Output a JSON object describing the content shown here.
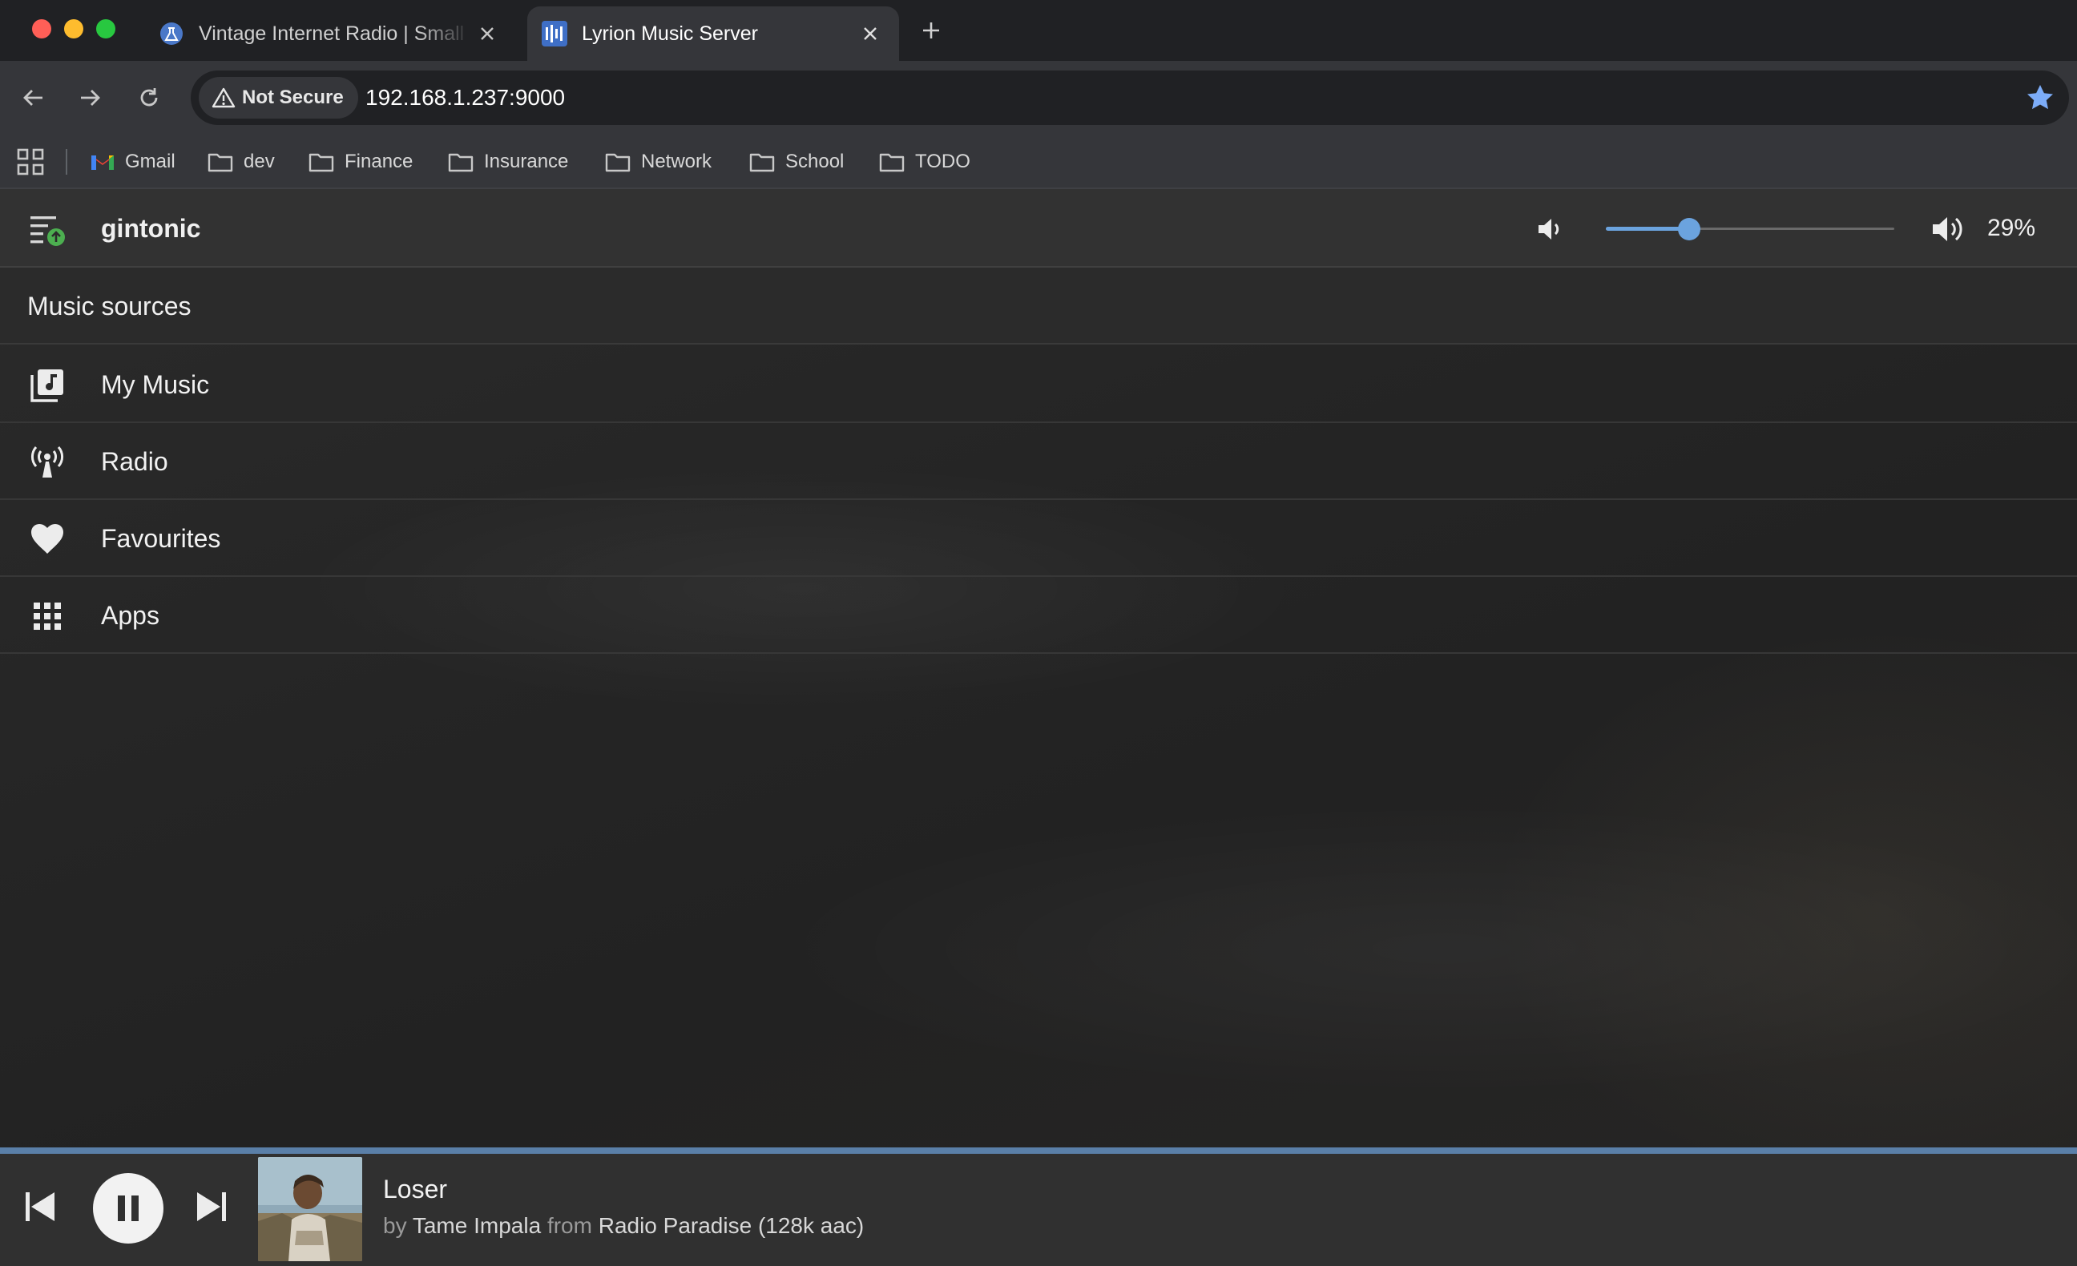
{
  "browser": {
    "tabs": [
      {
        "title": "Vintage Internet Radio | Small",
        "active": false,
        "favicon": "flask-icon"
      },
      {
        "title": "Lyrion Music Server",
        "active": true,
        "favicon": "lyrion-logo-icon"
      }
    ],
    "security_label": "Not Secure",
    "url": "192.168.1.237:9000",
    "bookmarks": [
      {
        "label": "Gmail",
        "icon": "gmail-icon"
      },
      {
        "label": "dev",
        "icon": "folder-icon"
      },
      {
        "label": "Finance",
        "icon": "folder-icon"
      },
      {
        "label": "Insurance",
        "icon": "folder-icon"
      },
      {
        "label": "Network",
        "icon": "folder-icon"
      },
      {
        "label": "School",
        "icon": "folder-icon"
      },
      {
        "label": "TODO",
        "icon": "folder-icon"
      }
    ]
  },
  "header": {
    "player_name": "gintonic",
    "volume_percent": 29,
    "volume_label": "29%"
  },
  "sources": {
    "title": "Music sources",
    "items": [
      {
        "label": "My Music",
        "icon": "music-library-icon"
      },
      {
        "label": "Radio",
        "icon": "radio-tower-icon"
      },
      {
        "label": "Favourites",
        "icon": "heart-icon"
      },
      {
        "label": "Apps",
        "icon": "apps-grid-icon"
      }
    ]
  },
  "now_playing": {
    "title": "Loser",
    "by_word": "by",
    "artist": "Tame Impala",
    "from_word": "from",
    "source": "Radio Paradise (128k aac)",
    "progress": 1.0,
    "state": "playing"
  },
  "colors": {
    "accent": "#6ba3de",
    "header_bg": "#323232",
    "content_bg": "#252525"
  }
}
